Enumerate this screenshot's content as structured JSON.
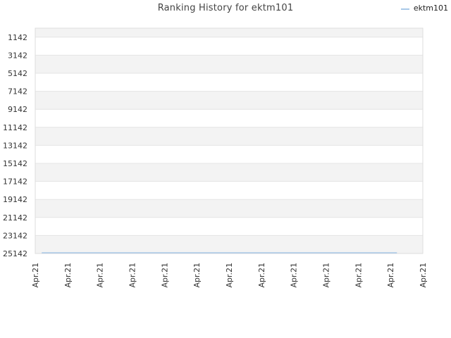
{
  "chart_data": {
    "type": "line",
    "title": "Ranking History for ektm101",
    "xlabel": "",
    "ylabel": "",
    "y_inverted": true,
    "ylim": [
      142,
      25142
    ],
    "y_ticks": [
      1142,
      3142,
      5142,
      7142,
      9142,
      11142,
      13142,
      15142,
      17142,
      19142,
      21142,
      23142,
      25142
    ],
    "x_tick_labels": [
      "Apr.21",
      "Apr.21",
      "Apr.21",
      "Apr.21",
      "Apr.21",
      "Apr.21",
      "Apr.21",
      "Apr.21",
      "Apr.21",
      "Apr.21",
      "Apr.21",
      "Apr.21",
      "Apr.21"
    ],
    "grid": true,
    "legend_position": "top-right",
    "series": [
      {
        "name": "ektm101",
        "color": "#a8c8e8",
        "x": [
          0.2,
          11.2
        ],
        "values": [
          25142,
          25142
        ]
      }
    ]
  },
  "colors": {
    "band_odd": "#f3f3f3",
    "band_even": "#ffffff",
    "grid": "#e4e4e4",
    "axis": "#dddddd"
  }
}
